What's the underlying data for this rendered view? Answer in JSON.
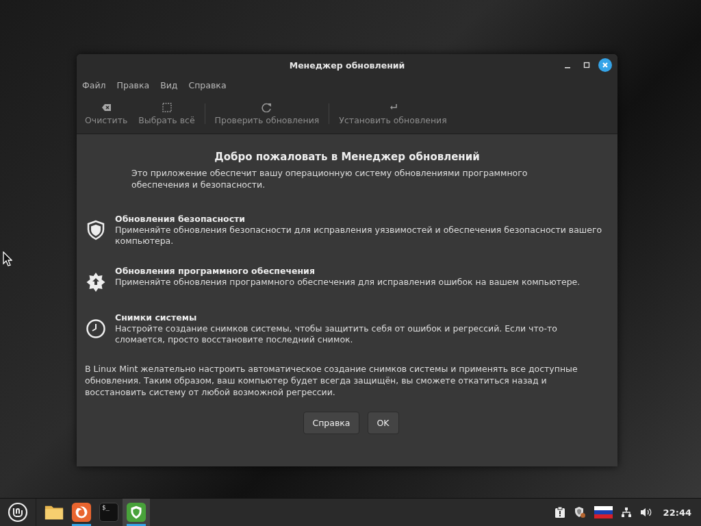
{
  "window": {
    "title": "Менеджер обновлений"
  },
  "menu": [
    "Файл",
    "Правка",
    "Вид",
    "Справка"
  ],
  "toolbar": [
    {
      "kind": "clear",
      "label": "Очистить",
      "disabled": true
    },
    {
      "kind": "select",
      "label": "Выбрать всё",
      "disabled": true
    },
    {
      "kind": "refresh",
      "label": "Проверить обновления",
      "disabled": true
    },
    {
      "kind": "install",
      "label": "Установить обновления",
      "disabled": true
    }
  ],
  "welcome": {
    "title": "Добро пожаловать в Менеджер обновлений",
    "intro": "Это приложение обеспечит вашу операционную систему обновлениями программного обеспечения и безопасности.",
    "features": [
      {
        "kind": "shield",
        "title": "Обновления безопасности",
        "text": "Применяйте обновления безопасности для исправления уязвимостей и обеспечения безопасности вашего компьютера."
      },
      {
        "kind": "star",
        "title": "Обновления программного обеспечения",
        "text": "Применяйте обновления программного обеспечения для исправления ошибок на вашем компьютере."
      },
      {
        "kind": "clock",
        "title": "Снимки системы",
        "text": "Настройте создание снимков системы, чтобы защитить себя от ошибок и регрессий. Если что-то сломается, просто восстановите последний снимок."
      }
    ],
    "note": "В Linux Mint желательно настроить автоматическое создание снимков системы и применять все доступные обновления. Таким образом, ваш компьютер будет всегда защищён, вы сможете откатиться назад и восстановить систему от любой возможной регрессии.",
    "buttons": [
      "Справка",
      "OK"
    ]
  },
  "taskbar": {
    "apps": [
      {
        "kind": "folder",
        "running": false,
        "active": false
      },
      {
        "kind": "browser",
        "running": true,
        "active": false
      },
      {
        "kind": "terminal",
        "glyph": "$_",
        "running": false,
        "active": false
      },
      {
        "kind": "update",
        "running": true,
        "active": true
      }
    ],
    "clock": "22:44"
  }
}
